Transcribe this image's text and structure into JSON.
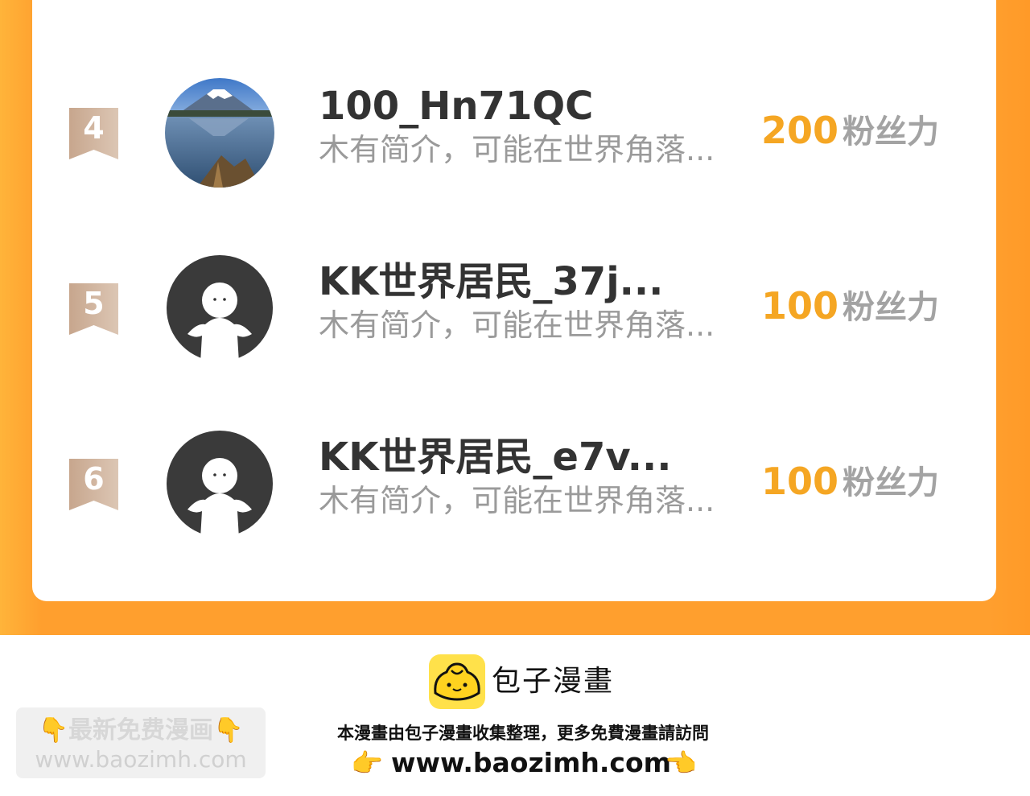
{
  "ranking": {
    "rows": [
      {
        "rank": "4",
        "name": "100_Hn71QC",
        "bio": "木有简介，可能在世界角落...",
        "score": "200",
        "unit": "粉丝力",
        "avatar": "mountain-lake-photo"
      },
      {
        "rank": "5",
        "name": "KK世界居民_37j...",
        "bio": "木有简介，可能在世界角落...",
        "score": "100",
        "unit": "粉丝力",
        "avatar": "default-user-icon"
      },
      {
        "rank": "6",
        "name": "KK世界居民_e7v...",
        "bio": "木有简介，可能在世界角落...",
        "score": "100",
        "unit": "粉丝力",
        "avatar": "default-user-icon"
      }
    ]
  },
  "footer": {
    "logo_title": "包子漫畫",
    "line": "本漫畫由包子漫畫收集整理，更多免費漫畫請訪問",
    "url": "www.baozimh.com",
    "left_hand": "👉",
    "right_hand": "👈"
  },
  "watermark": {
    "line1": "👇最新免费漫画👇",
    "line2": "www.baozimh.com"
  },
  "colors": {
    "accent": "#ff9f2e",
    "score": "#f5a623",
    "badge": "#c9ab95",
    "name": "#333333",
    "bio": "#9a9a9a"
  }
}
